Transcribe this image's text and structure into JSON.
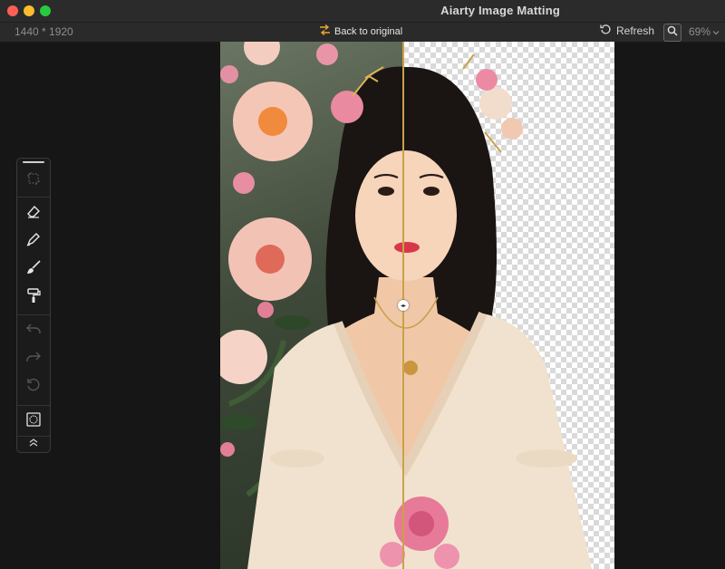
{
  "window": {
    "title": "Aiarty Image Matting"
  },
  "toolbar": {
    "dimensions": "1440 * 1920",
    "back_label": "Back to original",
    "refresh_label": "Refresh",
    "zoom": "69%"
  },
  "tools": [
    {
      "name": "crop-tool",
      "icon": "crop-icon",
      "enabled": false
    },
    {
      "name": "eraser-tool",
      "icon": "eraser-icon",
      "enabled": true
    },
    {
      "name": "pen-tool",
      "icon": "pen-icon",
      "enabled": true
    },
    {
      "name": "brush-tool",
      "icon": "brush-icon",
      "enabled": true
    },
    {
      "name": "roller-tool",
      "icon": "paint-roller-icon",
      "enabled": true
    },
    {
      "name": "undo",
      "icon": "undo-icon",
      "enabled": false
    },
    {
      "name": "redo",
      "icon": "redo-icon",
      "enabled": false
    },
    {
      "name": "reset",
      "icon": "reset-icon",
      "enabled": false
    },
    {
      "name": "background",
      "icon": "background-icon",
      "enabled": true
    },
    {
      "name": "collapse",
      "icon": "chevron-up-icon",
      "enabled": true
    }
  ],
  "compare": {
    "split_position": 0.465
  },
  "colors": {
    "split_line": "#c9a24a",
    "traffic_close": "#fe5f57",
    "traffic_min": "#febc2e",
    "traffic_max": "#28c840"
  }
}
